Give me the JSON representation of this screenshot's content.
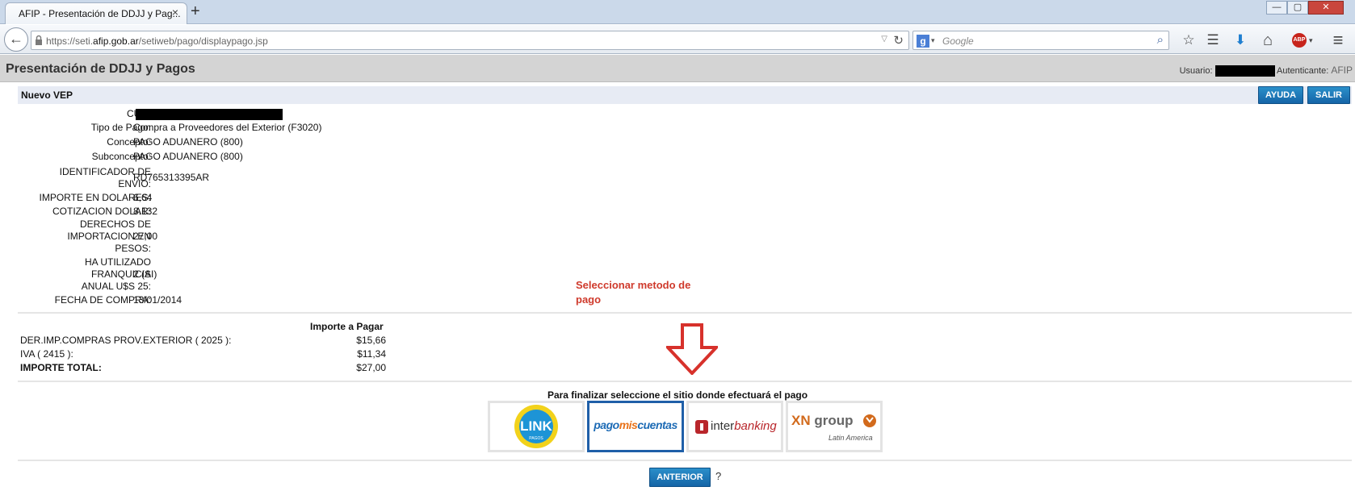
{
  "browser": {
    "tab_title": "AFIP - Presentación de DDJJ y Pag...",
    "tab_close": "×",
    "new_tab": "+",
    "window_buttons": [
      "—",
      "▢",
      "✕"
    ],
    "back": "←",
    "url_prefix": "https://seti.",
    "url_domain": "afip.gob.ar",
    "url_path": "/setiweb/pago/displaypago.jsp",
    "url_dropdown": "▽",
    "reload": "↻",
    "search_engine_letter": "g",
    "search_dropdown": "▾",
    "search_placeholder": "Google",
    "search_icon": "⌕",
    "toolbar_icons": {
      "bookmark": "☆",
      "reader": "☰",
      "download": "⬇",
      "home": "⌂",
      "adblock": "ABP",
      "adblock_dropdown": "▾",
      "menu": "≡"
    }
  },
  "header": {
    "title": "Presentación de DDJJ y Pagos",
    "user_label": "Usuario:",
    "auth_label": "Autenticante:",
    "auth_value": "AFIP"
  },
  "vep": {
    "title": "Nuevo VEP",
    "help_button": "AYUDA",
    "exit_button": "SALIR"
  },
  "details": [
    {
      "label": "CUIT:",
      "value": ""
    },
    {
      "label": "Tipo de Pago:",
      "value": "Compra a Proveedores del Exterior (F3020)"
    },
    {
      "label": "Concepto:",
      "value": "PAGO ADUANERO (800)"
    },
    {
      "label": "Subconcepto:",
      "value": "PAGO ADUANERO (800)"
    },
    {
      "label": "IDENTIFICADOR DE ENVIO:",
      "value": "RD765313395AR"
    },
    {
      "label": "IMPORTE EN DOLARES:",
      "value": "6,64"
    },
    {
      "label": "COTIZACION DOLAR:",
      "value": "8.132"
    },
    {
      "label": "DERECHOS DE IMPORTACION EN PESOS:",
      "value": "27,00"
    },
    {
      "label": "HA UTILIZADO FRANQUICIA ANUAL U$S 25:",
      "value": "2 (SI)"
    },
    {
      "label": "FECHA DE COMPRA:",
      "value": "13/01/2014"
    }
  ],
  "annotation": {
    "text": "Seleccionar metodo de pago",
    "arrow_color": "#d7312b"
  },
  "importes": {
    "header": "Importe a Pagar",
    "rows": [
      {
        "label": "DER.IMP.COMPRAS PROV.EXTERIOR ( 2025 ):",
        "amount": "$15,66"
      },
      {
        "label": "IVA ( 2415 ):",
        "amount": "$11,34"
      }
    ],
    "total_label": "IMPORTE TOTAL:",
    "total_amount": "$27,00"
  },
  "payment": {
    "title": "Para finalizar seleccione el sitio donde efectuará el pago",
    "options": {
      "link": {
        "logo_text": "LINK",
        "logo_sub": "PAGOS"
      },
      "pagomiscuentas": {
        "pre": "pago",
        "mid": "mis",
        "post": "cuentas"
      },
      "interbanking": {
        "pre": "inter",
        "post": "banking"
      },
      "xn": {
        "xn": "XN",
        "group": "group",
        "sub": "Latin America"
      }
    }
  },
  "footer": {
    "back_button": "ANTERIOR",
    "help": "?"
  },
  "colors": {
    "accent_blue": "#1565a7",
    "note_red": "#cf3a2c",
    "header_gray": "#d4d4d4"
  }
}
